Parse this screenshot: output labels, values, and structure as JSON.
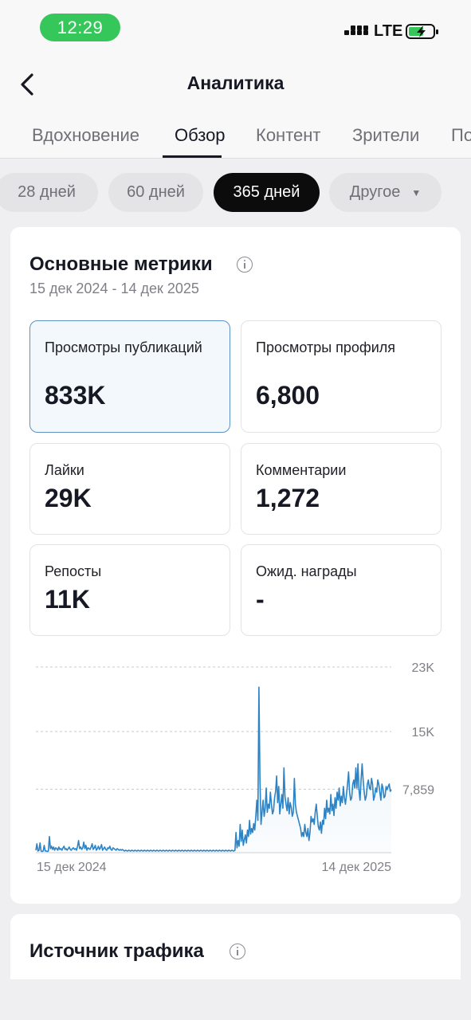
{
  "status_bar": {
    "time": "12:29",
    "network": "LTE"
  },
  "header": {
    "title": "Аналитика"
  },
  "tabs": [
    {
      "label": "Вдохновение",
      "active": false
    },
    {
      "label": "Обзор",
      "active": true
    },
    {
      "label": "Контент",
      "active": false
    },
    {
      "label": "Зрители",
      "active": false
    },
    {
      "label": "По",
      "active": false
    }
  ],
  "periods": [
    {
      "label": "28 дней",
      "active": false
    },
    {
      "label": "60 дней",
      "active": false
    },
    {
      "label": "365 дней",
      "active": true
    },
    {
      "label": "Другое",
      "active": false
    }
  ],
  "overview": {
    "title": "Основные метрики",
    "date_range": "15 дек 2024 - 14 дек 2025",
    "metrics": [
      {
        "label": "Просмотры публикаций",
        "value": "833K",
        "selected": true
      },
      {
        "label": "Просмотры профиля",
        "value": "6,800",
        "selected": false
      },
      {
        "label": "Лайки",
        "value": "29K",
        "selected": false
      },
      {
        "label": "Комментарии",
        "value": "1,272",
        "selected": false
      },
      {
        "label": "Репосты",
        "value": "11K",
        "selected": false
      },
      {
        "label": "Ожид. награды",
        "value": "-",
        "selected": false
      }
    ]
  },
  "chart_data": {
    "type": "area",
    "series": [
      {
        "values": [
          300,
          1100,
          200,
          300,
          1200,
          200,
          150,
          200,
          900,
          200,
          200,
          150,
          200,
          2000,
          500,
          800,
          400,
          700,
          300,
          600,
          500,
          300,
          700,
          400,
          500,
          300,
          600,
          800,
          400,
          500,
          300,
          500,
          700,
          400,
          300,
          500,
          600,
          400,
          500,
          300,
          800,
          1500,
          500,
          700,
          400,
          600,
          1300,
          500,
          900,
          300,
          600,
          500,
          400,
          700,
          1100,
          400,
          600,
          900,
          300,
          500,
          800,
          400,
          600,
          1000,
          300,
          500,
          700,
          400,
          300,
          600,
          500,
          800,
          400,
          300,
          600,
          500,
          400,
          300,
          500,
          400,
          300,
          400,
          300,
          400,
          300,
          200,
          300,
          250,
          200,
          300,
          250,
          200,
          300,
          250,
          200,
          300,
          250,
          200,
          300,
          250,
          200,
          300,
          250,
          200,
          300,
          250,
          200,
          300,
          250,
          200,
          300,
          250,
          200,
          300,
          250,
          200,
          300,
          250,
          200,
          300,
          250,
          200,
          300,
          250,
          200,
          300,
          250,
          200,
          300,
          250,
          200,
          300,
          250,
          200,
          300,
          250,
          200,
          300,
          250,
          200,
          300,
          250,
          200,
          300,
          250,
          200,
          300,
          250,
          200,
          300,
          250,
          200,
          300,
          250,
          200,
          300,
          250,
          200,
          300,
          250,
          200,
          300,
          250,
          200,
          300,
          250,
          200,
          300,
          250,
          200,
          300,
          250,
          200,
          300,
          250,
          200,
          300,
          250,
          200,
          300,
          250,
          200,
          300,
          250,
          200,
          300,
          250,
          200,
          300,
          250,
          200,
          300,
          2500,
          600,
          1500,
          800,
          3500,
          1400,
          2800,
          900,
          1600,
          2200,
          1200,
          2800,
          2000,
          4000,
          2300,
          3000,
          2500,
          3600,
          2800,
          4500,
          6500,
          4000,
          20500,
          9000,
          3500,
          5000,
          6500,
          4500,
          5500,
          8000,
          5000,
          6000,
          5500,
          7500,
          6000,
          4800,
          5200,
          6800,
          7600,
          9500,
          6200,
          8200,
          4800,
          6000,
          7200,
          5500,
          10500,
          7000,
          6000,
          5200,
          6800,
          4800,
          6200,
          5600,
          4500,
          5000,
          9200,
          6000,
          5000,
          4500,
          4000,
          3500,
          3000,
          2000,
          2500,
          2000,
          3500,
          2500,
          2000,
          3000,
          1500,
          2500,
          4500,
          3800,
          4200,
          3500,
          5000,
          6000,
          4500,
          3200,
          2800,
          3800,
          2400,
          4000,
          3500,
          5500,
          4200,
          6500,
          5000,
          5500,
          4800,
          7200,
          5200,
          6000,
          4600,
          6800,
          5500,
          7500,
          6500,
          8000,
          5800,
          7000,
          6200,
          8200,
          6800,
          6000,
          7200,
          8500,
          10000,
          7500,
          6500,
          6800,
          8500,
          9000,
          8000,
          10500,
          8000,
          11000,
          7800,
          6500,
          9000,
          11000,
          9000,
          7500,
          6500,
          7000,
          8500,
          9000,
          8000,
          7800,
          9200,
          8500,
          6500,
          7000,
          8000,
          7500,
          9000,
          8500,
          7500,
          6500,
          8500,
          8000,
          6800,
          7000,
          8200,
          7800,
          8200,
          8500,
          7600,
          7800
        ]
      }
    ],
    "x_labels": [
      "15 дек 2024",
      "14 дек 2025"
    ],
    "y_ticks": [
      "23K",
      "15K",
      "7,859"
    ],
    "ylim": [
      0,
      23000
    ],
    "grid": true,
    "color": "#2d83c4"
  },
  "traffic": {
    "title": "Источник трафика"
  }
}
